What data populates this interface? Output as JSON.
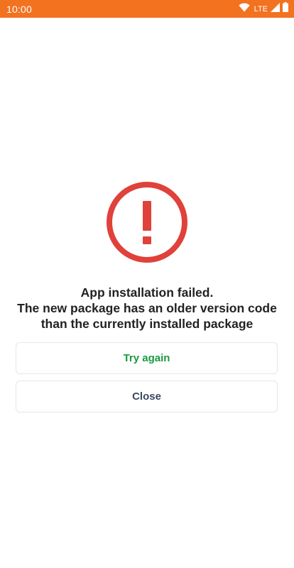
{
  "status_bar": {
    "time": "10:00",
    "network": "LTE",
    "background_color": "#f27220",
    "icons": [
      "wifi-icon",
      "signal-icon",
      "battery-icon"
    ]
  },
  "error": {
    "icon": "exclamation-circle-icon",
    "color": "#e0413a",
    "message_lines": [
      "App installation failed.",
      "The new package has an older version code",
      "than the currently installed package"
    ]
  },
  "actions": {
    "try_again_label": "Try again",
    "try_again_color": "#1a9a3e",
    "close_label": "Close",
    "close_color": "#3a4a63"
  }
}
